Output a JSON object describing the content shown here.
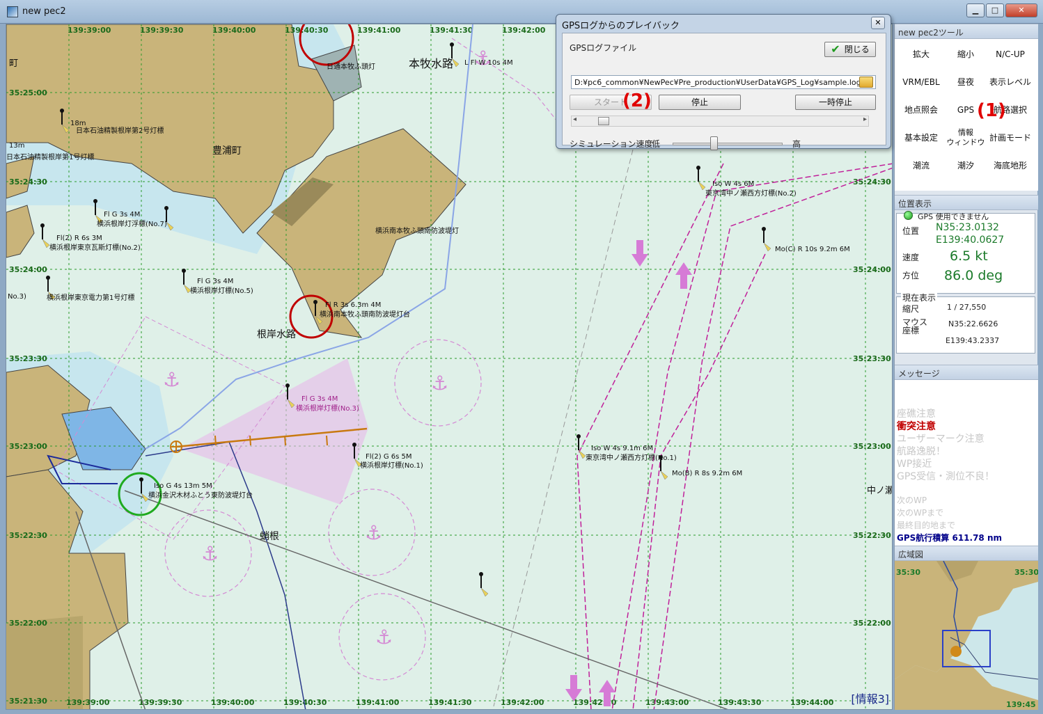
{
  "window": {
    "title": "new pec2",
    "min": "▁",
    "max": "□",
    "close": "✕"
  },
  "chart": {
    "lon_labels_top": [
      "139:39:00",
      "139:39:30",
      "139:40:00",
      "139:40:30",
      "139:41:00",
      "139:41:30",
      "139:42:00"
    ],
    "lon_labels_bottom": [
      "139:39:00",
      "139:39:30",
      "139:40:00",
      "139:40:30",
      "139:41:00",
      "139:41:30",
      "139:42:00",
      "139:42:30",
      "139:43:00",
      "139:43:30",
      "139:44:00"
    ],
    "lat_labels_left": [
      "35:25:00",
      "35:24:30",
      "35:24:00",
      "35:23:30",
      "35:23:00",
      "35:22:30",
      "35:22:00",
      "35:21:30"
    ],
    "lat_labels_right": [
      "35:24:30",
      "35:24:00",
      "35:23:30",
      "35:23:00",
      "35:22:30",
      "35:22:00"
    ],
    "place_names": [
      "本牧水路",
      "豊浦町",
      "根岸水路",
      "蛸根",
      "中ノ瀬",
      "町"
    ],
    "buoy_labels": [
      "L Fl W 10s 4M",
      "日本石油精製根岸第2号灯標",
      "日本石油精製根岸第1号灯標",
      "Fl G 3s 4M",
      "横浜根岸灯浮標(No.7)",
      "Fl(2) R 6s 3M",
      "横浜根岸東京瓦斯灯標(No.2)",
      "Fl G 3s 4M",
      "横浜根岸灯標(No.5)",
      "横浜根岸東京電力第1号灯標",
      "Fl R 3s 6.3m 4M",
      "横浜南本牧ふ頭南防波堤灯台",
      "横浜南本牧ふ頭南防波堤灯",
      "Fl G 3s 4M",
      "横浜根岸灯標(No.3)",
      "Fl(2) G 6s 5M",
      "横浜根岸灯標(No.1)",
      "Iso G 4s 13m 5M",
      "横浜金沢木材ふとう東防波堤灯台",
      "Iso W 4s 6M",
      "東京湾中ノ瀬西方灯標(No.2)",
      "Mo(C) R 10s 9.2m 6M",
      "Iso W 4s 9.1m 6M",
      "東京湾中ノ瀬西方灯標(No.1)",
      "Mo(B) R 8s 9.2m 6M",
      "18m",
      "13m",
      "日通本牧ふ頭灯",
      "No.3)"
    ],
    "info_label": "[情報3]"
  },
  "panel": {
    "tools_header": "new pec2ツール",
    "tools": [
      "拡大",
      "縮小",
      "N/C-UP",
      "VRM/EBL",
      "昼夜",
      "表示レベル",
      "地点照会",
      "GPS",
      "航路選択",
      "基本設定",
      "情報\nウィンドウ",
      "計画モード",
      "潮流",
      "潮汐",
      "海底地形"
    ],
    "annotation_1": "(1)",
    "position_header": "位置表示",
    "gps_status": "GPS 使用できません",
    "pos_label": "位置",
    "lat": "N35:23.0132",
    "lon": "E139:40.0627",
    "speed_label": "速度",
    "speed": "6.5 kt",
    "heading_label": "方位",
    "heading": "86.0 deg",
    "current_header": "現在表示",
    "scale_label": "縮尺",
    "scale": "1 / 27,550",
    "mouse_label": "マウス\n座標",
    "mouse_lat": "N35:22.6626",
    "mouse_lon": "E139:43.2337",
    "message_header": "メッセージ",
    "messages": [
      "座礁注意",
      "衝突注意",
      "ユーザーマーク注意",
      "航路逸脱！",
      "WP接近",
      "GPS受信・測位不良！"
    ],
    "next_wp": "次のWP",
    "to_next_wp": "次のWPまで",
    "to_final": "最終目的地まで",
    "gps_total": "GPS航行積算 611.78 nm",
    "overview_header": "広域図",
    "overview_lat1": "35:30",
    "overview_lat2": "35:30",
    "overview_lon": "139:45"
  },
  "dialog": {
    "title": "GPSログからのプレイバック",
    "file_label": "GPSログファイル",
    "close_label": "閉じる",
    "file_path": "D:¥pc6_common¥NewPec¥Pre_production¥UserData¥GPS_Log¥sample.log",
    "start_label": "スタート",
    "stop_label": "停止",
    "pause_label": "一時停止",
    "annotation_2": "(2)",
    "speed_label": "シミュレーション速度",
    "slow": "低",
    "fast": "高",
    "x": "✕"
  },
  "colors": {
    "land": "#c9b47a",
    "sea": "#dff0e8",
    "grid": "#2a9a2a",
    "annotation": "#e00000",
    "lane": "#c0209a"
  }
}
